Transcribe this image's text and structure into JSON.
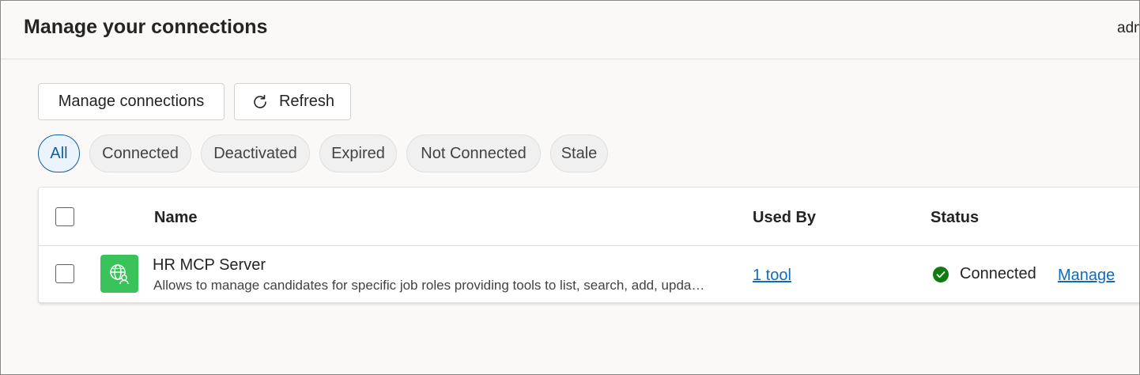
{
  "header": {
    "title": "Manage your connections",
    "user_label": "adm"
  },
  "toolbar": {
    "manage_label": "Manage connections",
    "refresh_label": "Refresh"
  },
  "filters": [
    {
      "label": "All",
      "active": true
    },
    {
      "label": "Connected",
      "active": false
    },
    {
      "label": "Deactivated",
      "active": false
    },
    {
      "label": "Expired",
      "active": false
    },
    {
      "label": "Not Connected",
      "active": false
    },
    {
      "label": "Stale",
      "active": false
    }
  ],
  "table": {
    "columns": {
      "name": "Name",
      "used_by": "Used By",
      "status": "Status"
    },
    "rows": [
      {
        "name": "HR MCP Server",
        "description": "Allows to manage candidates for specific job roles providing tools to list, search, add, upda…",
        "icon": "globe-person-icon",
        "used_by": "1 tool",
        "status": "Connected",
        "action": "Manage"
      }
    ]
  },
  "colors": {
    "accent": "#0f6cbd",
    "active_pill_bg": "#ebf3fc",
    "app_icon_bg": "#39c35a",
    "status_ok": "#107c10"
  }
}
